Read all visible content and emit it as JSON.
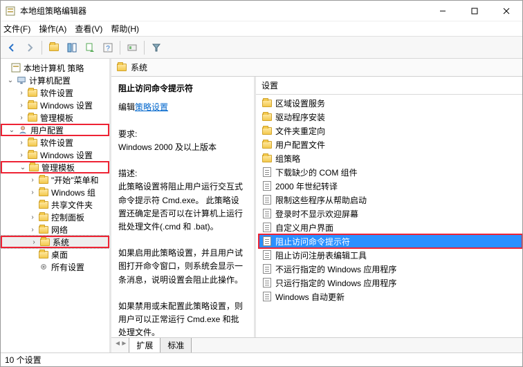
{
  "window": {
    "title": "本地组策略编辑器"
  },
  "menu": {
    "file": "文件(F)",
    "action": "操作(A)",
    "view": "查看(V)",
    "help": "帮助(H)"
  },
  "tree": {
    "root": "本地计算机 策略",
    "computer": "计算机配置",
    "computer_children": [
      "软件设置",
      "Windows 设置",
      "管理模板"
    ],
    "user": "用户配置",
    "user_children": {
      "software": "软件设置",
      "windows": "Windows 设置",
      "admin": "管理模板",
      "admin_children": {
        "start": "\"开始\"菜单和",
        "wincomp": "Windows 组",
        "shared": "共享文件夹",
        "control": "控制面板",
        "network": "网络",
        "system": "系统",
        "desktop": "桌面",
        "allsettings": "所有设置"
      }
    }
  },
  "crumb": {
    "title": "系统"
  },
  "desc": {
    "heading": "阻止访问命令提示符",
    "edit_prefix": "编辑",
    "edit_link": "策略设置",
    "req_label": "要求:",
    "req_value": "Windows 2000 及以上版本",
    "desc_label": "描述:",
    "desc_p1": "此策略设置将阻止用户运行交互式命令提示符 Cmd.exe。  此策略设置还确定是否可以在计算机上运行批处理文件(.cmd 和 .bat)。",
    "desc_p2": "如果启用此策略设置，并且用户试图打开命令窗口，则系统会显示一条消息，说明设置会阻止此操作。",
    "desc_p3": "如果禁用或未配置此策略设置，则用户可以正常运行 Cmd.exe 和批处理文件。"
  },
  "list": {
    "header": "设置",
    "items": [
      {
        "type": "folder",
        "label": "区域设置服务"
      },
      {
        "type": "folder",
        "label": "驱动程序安装"
      },
      {
        "type": "folder",
        "label": "文件夹重定向"
      },
      {
        "type": "folder",
        "label": "用户配置文件"
      },
      {
        "type": "folder",
        "label": "组策略"
      },
      {
        "type": "doc",
        "label": "下载缺少的 COM 组件"
      },
      {
        "type": "doc",
        "label": "2000 年世纪转译"
      },
      {
        "type": "doc",
        "label": "限制这些程序从帮助启动"
      },
      {
        "type": "doc",
        "label": "登录时不显示欢迎屏幕"
      },
      {
        "type": "doc",
        "label": "自定义用户界面"
      },
      {
        "type": "doc",
        "label": "阻止访问命令提示符",
        "selected": true,
        "highlight": true
      },
      {
        "type": "doc",
        "label": "阻止访问注册表编辑工具"
      },
      {
        "type": "doc",
        "label": "不运行指定的 Windows 应用程序"
      },
      {
        "type": "doc",
        "label": "只运行指定的 Windows 应用程序"
      },
      {
        "type": "doc",
        "label": "Windows 自动更新"
      }
    ]
  },
  "tabs": {
    "extended": "扩展",
    "standard": "标准"
  },
  "status": {
    "text": "10 个设置"
  }
}
